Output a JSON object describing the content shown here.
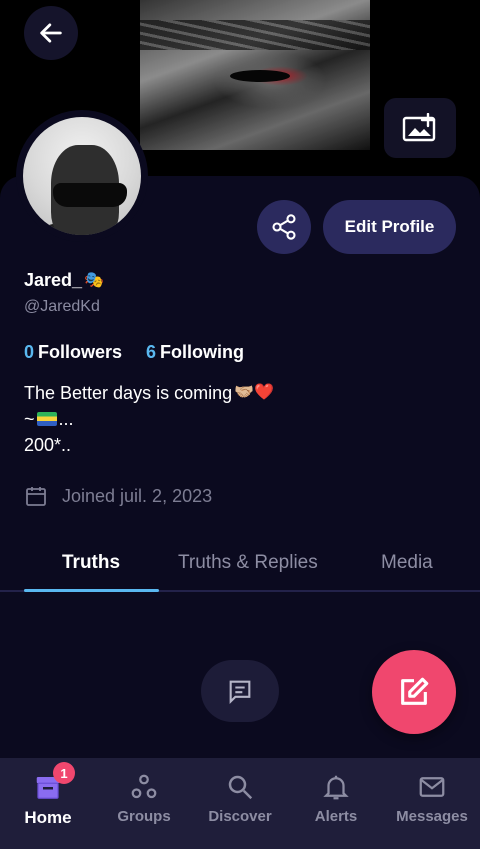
{
  "profile": {
    "name": "Jared_",
    "name_emoji": "🎭",
    "handle": "@JaredKd",
    "followers_count": "0",
    "followers_label": "Followers",
    "following_count": "6",
    "following_label": "Following",
    "bio_line1": "The Better days is coming",
    "bio_line1_emoji": "🤝🏼❤️",
    "bio_line2_prefix": "~",
    "bio_line2_suffix": "...",
    "bio_line3": "200*..",
    "joined": "Joined juil. 2, 2023"
  },
  "actions": {
    "edit_profile": "Edit Profile"
  },
  "tabs": [
    {
      "label": "Truths",
      "active": true
    },
    {
      "label": "Truths & Replies",
      "active": false
    },
    {
      "label": "Media",
      "active": false
    }
  ],
  "bottom_nav": {
    "home": "Home",
    "home_badge": "1",
    "groups": "Groups",
    "discover": "Discover",
    "alerts": "Alerts",
    "messages": "Messages"
  },
  "icons": {
    "back": "arrow-left-icon",
    "photo": "add-photo-icon",
    "share": "share-icon",
    "calendar": "calendar-icon",
    "comment": "comment-icon",
    "compose": "compose-icon"
  },
  "colors": {
    "background": "#0b0a1f",
    "accent_blue": "#5ab8f0",
    "accent_pink": "#f0476e",
    "button_bg": "#2b2a5e",
    "nav_bg": "#1f1e3a"
  }
}
